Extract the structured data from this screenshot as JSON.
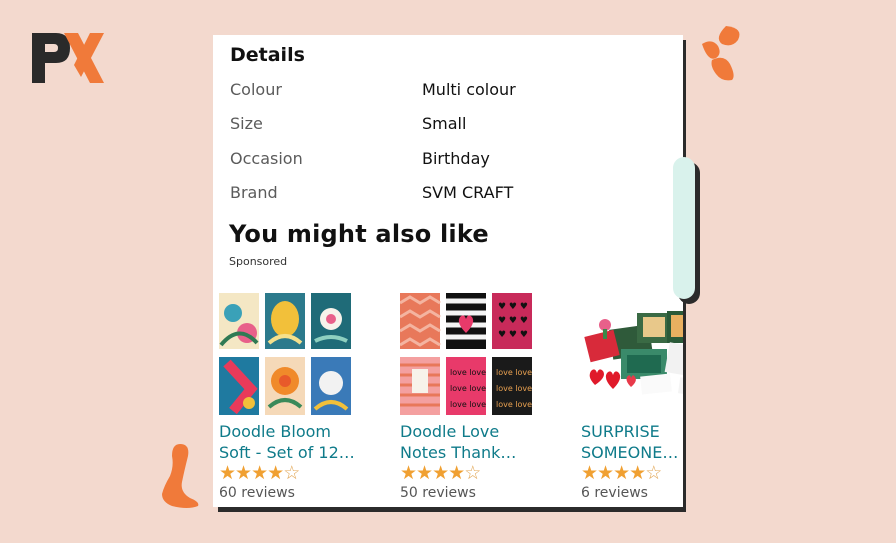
{
  "details": {
    "title": "Details",
    "rows": [
      {
        "key": "Colour",
        "value": "Multi colour"
      },
      {
        "key": "Size",
        "value": "Small"
      },
      {
        "key": "Occasion",
        "value": "Birthday"
      },
      {
        "key": "Brand",
        "value": "SVM CRAFT"
      }
    ]
  },
  "recommendations": {
    "title": "You might also like",
    "sponsored_label": "Sponsored",
    "products": [
      {
        "title_line1": "Doodle Bloom",
        "title_line2": "Soft - Set of 12…",
        "rating": 4,
        "reviews": "60 reviews"
      },
      {
        "title_line1": "Doodle Love",
        "title_line2": "Notes Thank…",
        "rating": 4,
        "reviews": "50 reviews"
      },
      {
        "title_line1": "SURPRISE",
        "title_line2": "SOMEONE…",
        "rating": 4,
        "reviews": "6 reviews"
      }
    ]
  },
  "colors": {
    "background": "#f3d9ce",
    "accent_orange": "#f07a3a",
    "link_teal": "#0f7b8a",
    "star": "#f0a032",
    "scrollbar": "#d9f2ec"
  },
  "icons": [
    "px-logo-icon",
    "splash-decoration-icon"
  ]
}
